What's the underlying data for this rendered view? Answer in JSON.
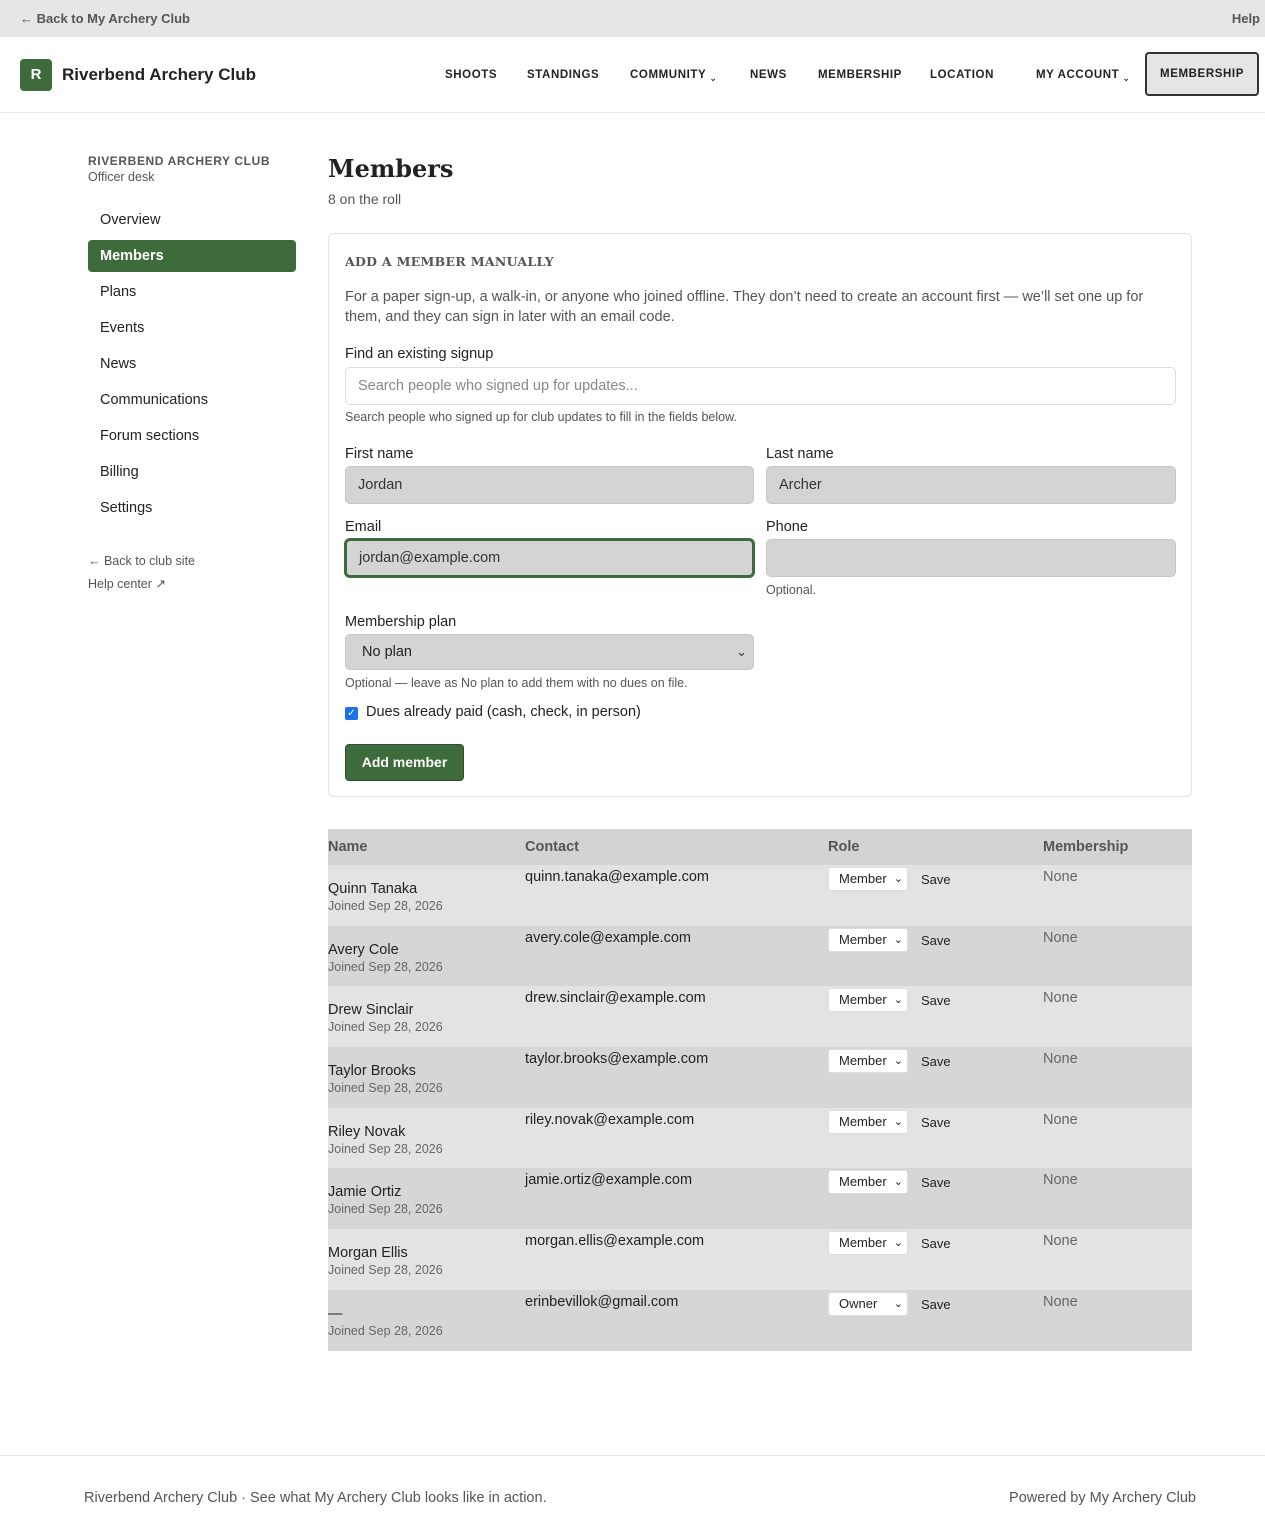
{
  "topbar": {
    "back": "← Back to My Archery Club",
    "help": "Help"
  },
  "header": {
    "logo_letter": "R",
    "brand": "Riverbend Archery Club",
    "nav": [
      "SHOOTS",
      "STANDINGS",
      "COMMUNITY",
      "NEWS",
      "MEMBERSHIP",
      "LOCATION",
      "MY ACCOUNT"
    ],
    "caret": "⌄",
    "cta": "MEMBERSHIP"
  },
  "sidebar": {
    "club": "RIVERBEND ARCHERY CLUB",
    "sub": "Officer desk",
    "items": [
      "Overview",
      "Members",
      "Plans",
      "Events",
      "News",
      "Communications",
      "Forum sections",
      "Billing",
      "Settings"
    ],
    "active": "Members",
    "back_link": "← Back to club site",
    "help_link": "Help center ↗"
  },
  "main": {
    "title": "Members",
    "subtitle": "8 on the roll"
  },
  "form": {
    "title": "ADD A MEMBER MANUALLY",
    "desc": "For a paper sign-up, a walk-in, or anyone who joined offline. They don’t need to create an account first — we’ll set one up for them, and they can sign in later with an email code.",
    "find_label": "Find an existing signup",
    "find_placeholder": "Search people who signed up for updates...",
    "find_hint": "Search people who signed up for club updates to fill in the fields below.",
    "first_label": "First name",
    "first_value": "Jordan",
    "last_label": "Last name",
    "last_value": "Archer",
    "email_label": "Email",
    "email_value": "jordan@example.com",
    "phone_label": "Phone",
    "phone_value": "",
    "phone_hint": "Optional.",
    "plan_label": "Membership plan",
    "plan_value": "No plan",
    "plan_hint": "Optional — leave as No plan to add them with no dues on file.",
    "paid_label": "Dues already paid (cash, check, in person)",
    "paid_checked": true,
    "check_mark": "✓",
    "submit": "Add member"
  },
  "table": {
    "headers": [
      "Name",
      "Contact",
      "Role",
      "Membership"
    ],
    "save_label": "Save",
    "chevron": "⌄",
    "rows": [
      {
        "name": "Quinn Tanaka",
        "joined": "Joined Sep 28, 2026",
        "email": "quinn.tanaka@example.com",
        "role": "Member",
        "membership": "None"
      },
      {
        "name": "Avery Cole",
        "joined": "Joined Sep 28, 2026",
        "email": "avery.cole@example.com",
        "role": "Member",
        "membership": "None"
      },
      {
        "name": "Drew Sinclair",
        "joined": "Joined Sep 28, 2026",
        "email": "drew.sinclair@example.com",
        "role": "Member",
        "membership": "None"
      },
      {
        "name": "Taylor Brooks",
        "joined": "Joined Sep 28, 2026",
        "email": "taylor.brooks@example.com",
        "role": "Member",
        "membership": "None"
      },
      {
        "name": "Riley Novak",
        "joined": "Joined Sep 28, 2026",
        "email": "riley.novak@example.com",
        "role": "Member",
        "membership": "None"
      },
      {
        "name": "Jamie Ortiz",
        "joined": "Joined Sep 28, 2026",
        "email": "jamie.ortiz@example.com",
        "role": "Member",
        "membership": "None"
      },
      {
        "name": "Morgan Ellis",
        "joined": "Joined Sep 28, 2026",
        "email": "morgan.ellis@example.com",
        "role": "Member",
        "membership": "None"
      },
      {
        "name": "—",
        "joined": "Joined Sep 28, 2026",
        "email": "erinbevillok@gmail.com",
        "role": "Owner",
        "membership": "None"
      }
    ]
  },
  "footer": {
    "left": "Riverbend Archery Club · See what My Archery Club looks like in action.",
    "right": "Powered by My Archery Club"
  },
  "colors": {
    "accent": "#3e6b3b",
    "checkbox": "#1a73e8"
  }
}
